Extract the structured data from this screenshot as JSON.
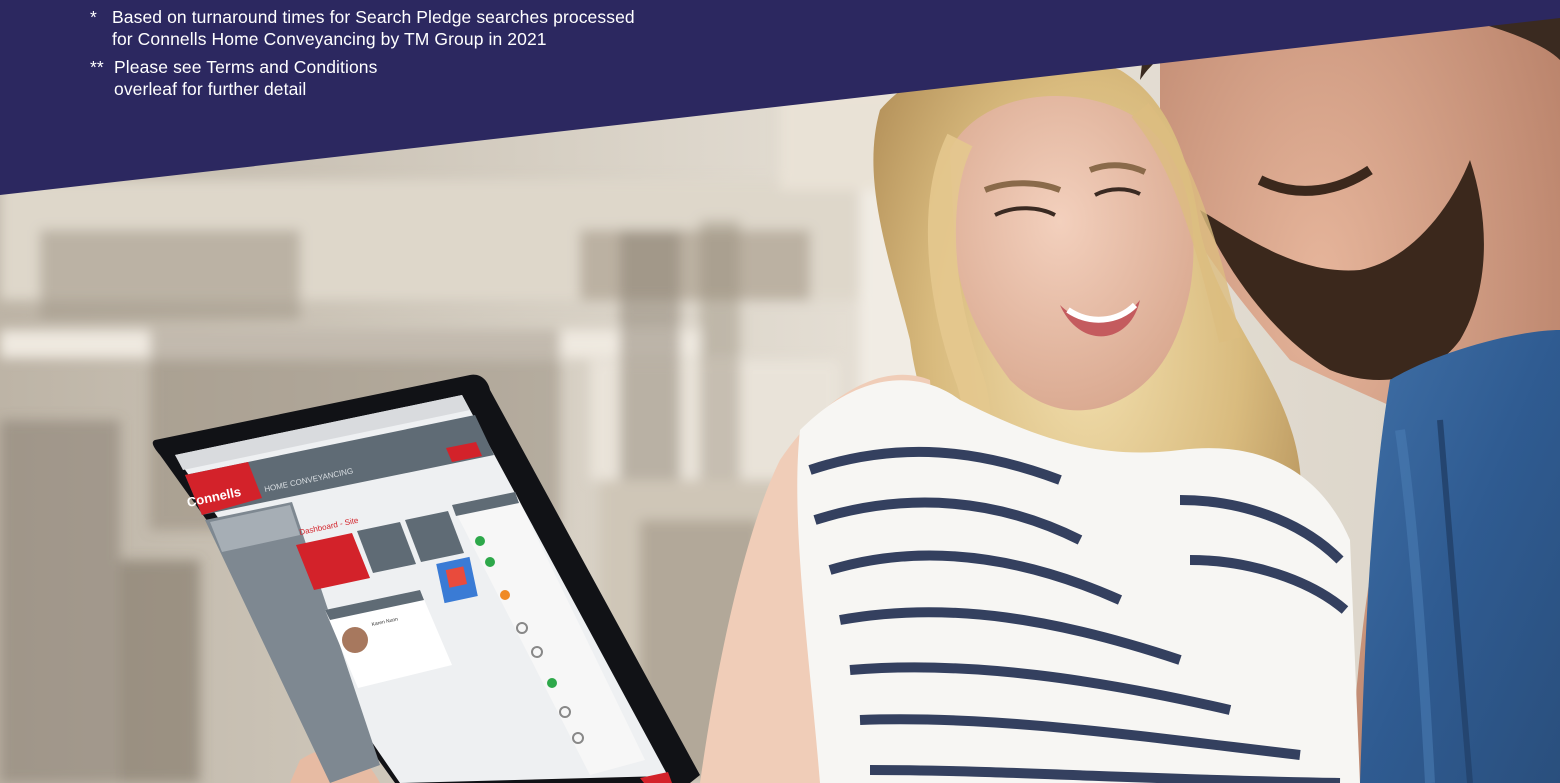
{
  "banner": {
    "background": "#2c2860",
    "footnotes": [
      {
        "mark": "*",
        "lines": [
          "Based on turnaround times for Search Pledge searches processed",
          "for Connells Home Conveyancing by TM Group in 2021"
        ]
      },
      {
        "mark": "**",
        "lines": [
          "Please see Terms and Conditions",
          "overleaf for further detail"
        ]
      }
    ]
  },
  "tablet_screen": {
    "brand": "Connells",
    "header_title": "HOME CONVEYANCING",
    "dashboard_title": "Dashboard - Site",
    "contact_name": "Karen Nunn",
    "accent": "#d3222a"
  }
}
